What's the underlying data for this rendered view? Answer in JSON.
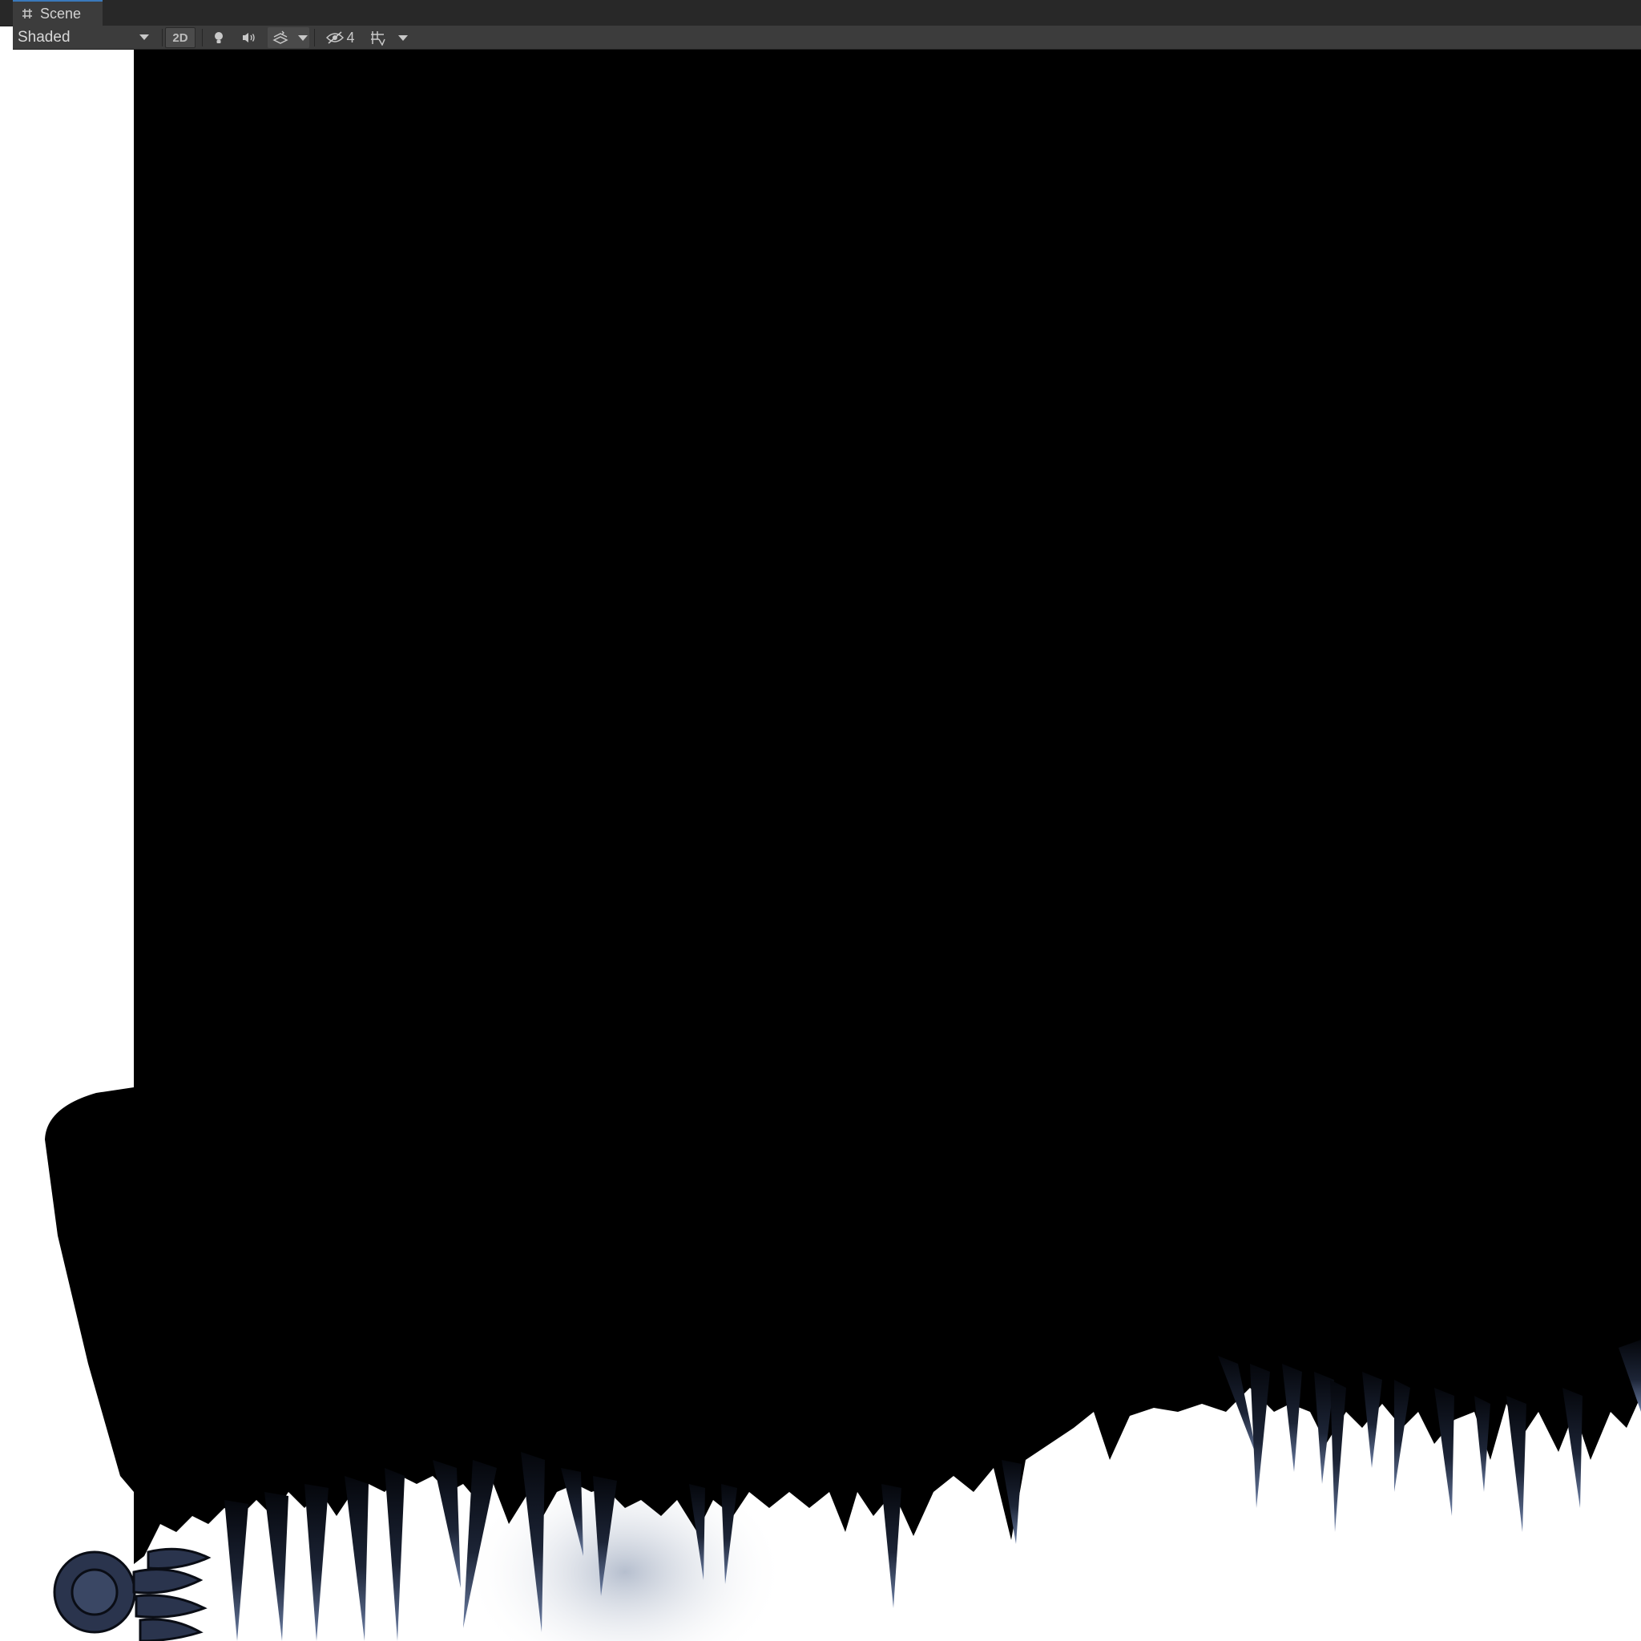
{
  "window": {
    "tab_label": "Scene",
    "tab_icon": "grid-hash-icon"
  },
  "toolbar": {
    "draw_mode": "Shaded",
    "twod_label": "2D",
    "hidden_count": "4",
    "icons": [
      "light-bulb-icon",
      "audio-icon",
      "effects-icon",
      "visibility-icon",
      "gizmos-icon"
    ]
  },
  "colors": {
    "tabbar_bg": "#282828",
    "toolbar_bg": "#3c3c3c",
    "accent": "#3a79bb",
    "cave_black": "#000000",
    "crystal_blue": "#3a4a6c"
  }
}
